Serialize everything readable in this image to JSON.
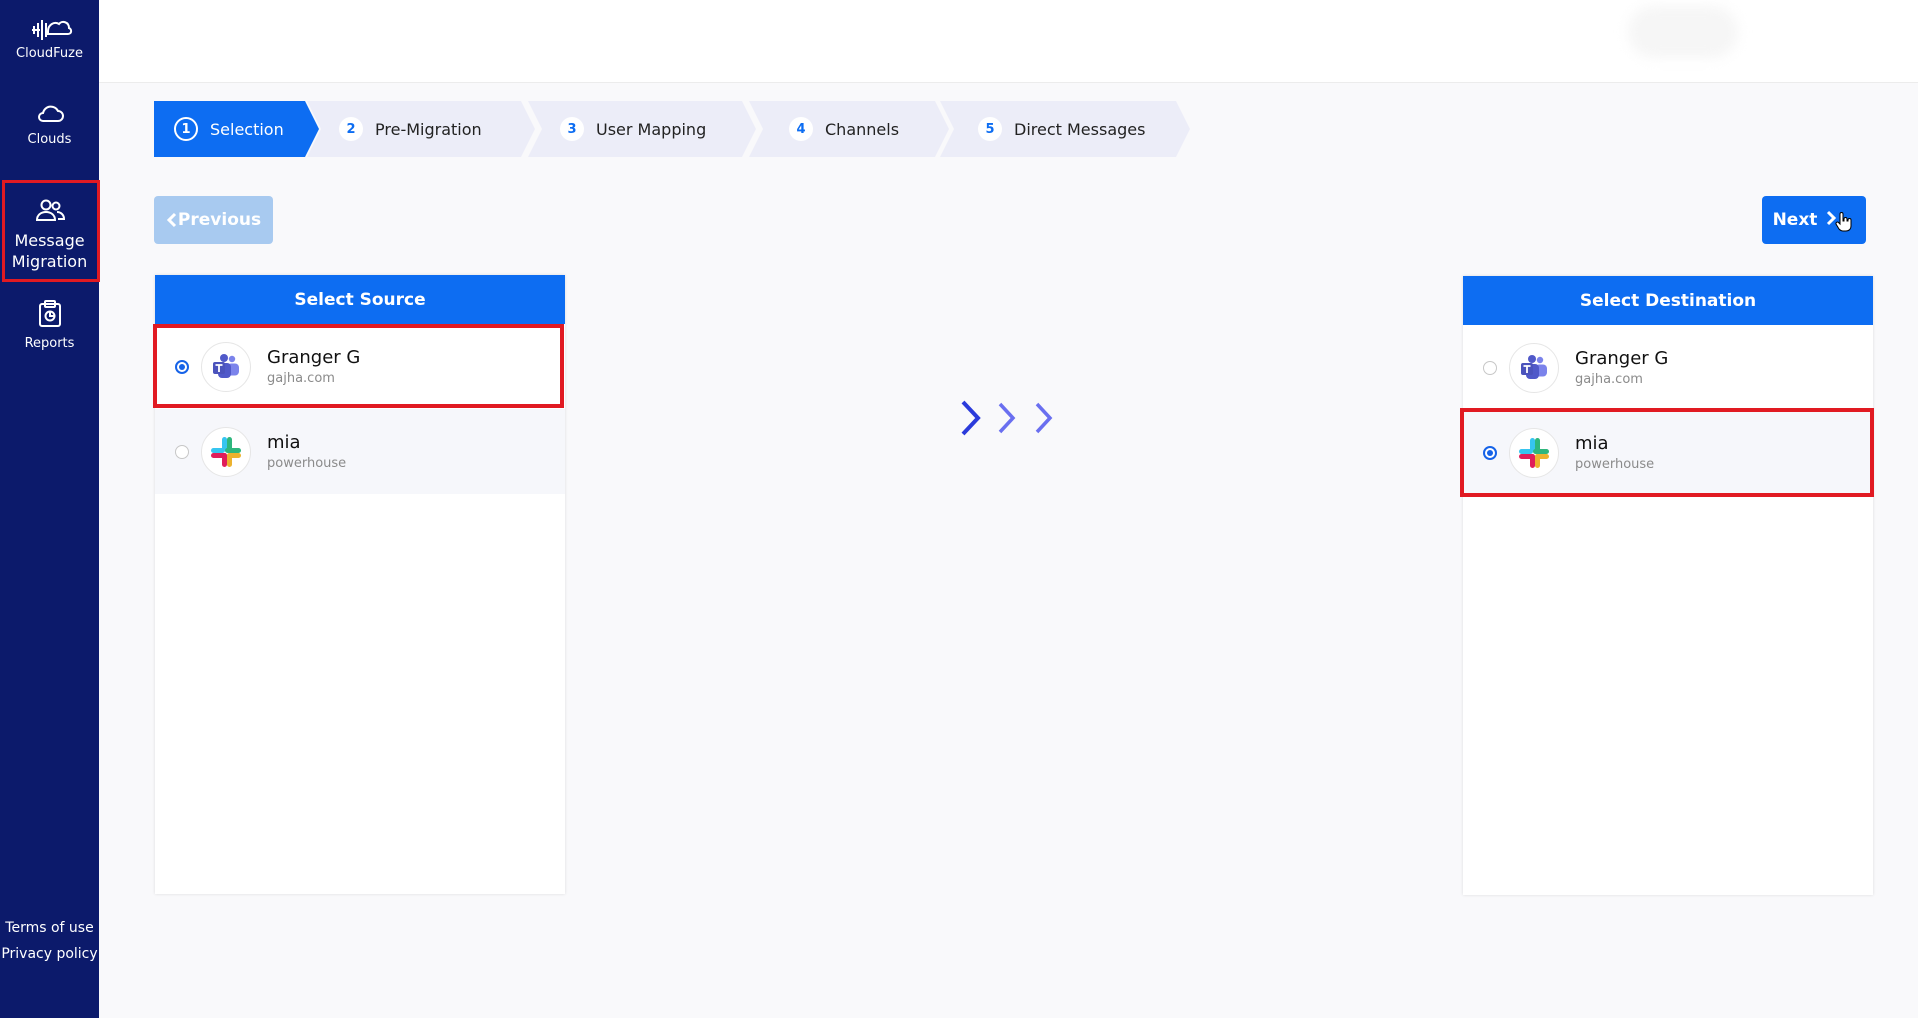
{
  "sidebar": {
    "brand": "CloudFuze",
    "items": [
      {
        "label": "Clouds",
        "icon": "cloud-icon"
      },
      {
        "label": "Message Migration",
        "icon": "users-icon",
        "active": true
      },
      {
        "label": "Reports",
        "icon": "clipboard-icon"
      }
    ],
    "footer": {
      "terms": "Terms of use",
      "privacy": "Privacy policy"
    }
  },
  "stepper": {
    "steps": [
      {
        "num": "1",
        "label": "Selection",
        "active": true
      },
      {
        "num": "2",
        "label": "Pre-Migration"
      },
      {
        "num": "3",
        "label": "User Mapping"
      },
      {
        "num": "4",
        "label": "Channels"
      },
      {
        "num": "5",
        "label": "Direct Messages"
      }
    ]
  },
  "buttons": {
    "previous": "Previous",
    "next": "Next"
  },
  "source": {
    "title": "Select Source",
    "accounts": [
      {
        "name": "Granger G",
        "sub": "gajha.com",
        "icon": "teams-icon",
        "selected": true
      },
      {
        "name": "mia",
        "sub": "powerhouse",
        "icon": "slack-icon",
        "selected": false
      }
    ]
  },
  "destination": {
    "title": "Select Destination",
    "accounts": [
      {
        "name": "Granger G",
        "sub": "gajha.com",
        "icon": "teams-icon",
        "selected": false
      },
      {
        "name": "mia",
        "sub": "powerhouse",
        "icon": "slack-icon",
        "selected": true
      }
    ]
  },
  "colors": {
    "primary": "#0d6df2",
    "sidebar": "#0c1a6b",
    "highlight": "#e11a22"
  }
}
